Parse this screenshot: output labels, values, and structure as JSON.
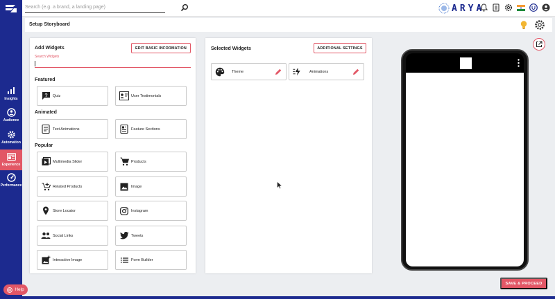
{
  "search": {
    "placeholder": "Search (e.g. a brand, a landing page)"
  },
  "brand": {
    "name": "ARYA"
  },
  "nav": [
    {
      "label": "Insights",
      "icon": "bar-chart-icon"
    },
    {
      "label": "Audience",
      "icon": "audience-icon"
    },
    {
      "label": "Automation",
      "icon": "automation-gear-icon"
    },
    {
      "label": "Experience",
      "icon": "experience-icon"
    },
    {
      "label": "Performance",
      "icon": "speedometer-icon"
    }
  ],
  "page": {
    "title": "Setup Storyboard"
  },
  "add_widgets": {
    "title": "Add Widgets",
    "edit_button": "EDIT BASIC INFORMATION",
    "search_label": "Search Widgets",
    "sections": {
      "featured": "Featured",
      "animated": "Animated",
      "popular": "Popular"
    },
    "featured": [
      "Quiz",
      "User Testimonials"
    ],
    "animated": [
      "Text Animations",
      "Feature Sections"
    ],
    "popular": [
      "Multimedia Slider",
      "Products",
      "Related Products",
      "Image",
      "Store Locator",
      "Instagram",
      "Social Links",
      "Tweets",
      "Interactive Image",
      "Form Builder"
    ]
  },
  "selected_widgets": {
    "title": "Selected Widgets",
    "settings_button": "ADDITIONAL SETTINGS",
    "items": [
      "Theme",
      "Animations"
    ]
  },
  "footer": {
    "save_button": "SAVE & PROCEED",
    "help": "Help"
  },
  "colors": {
    "primary": "#1c2a8f",
    "accent": "#e25766"
  }
}
